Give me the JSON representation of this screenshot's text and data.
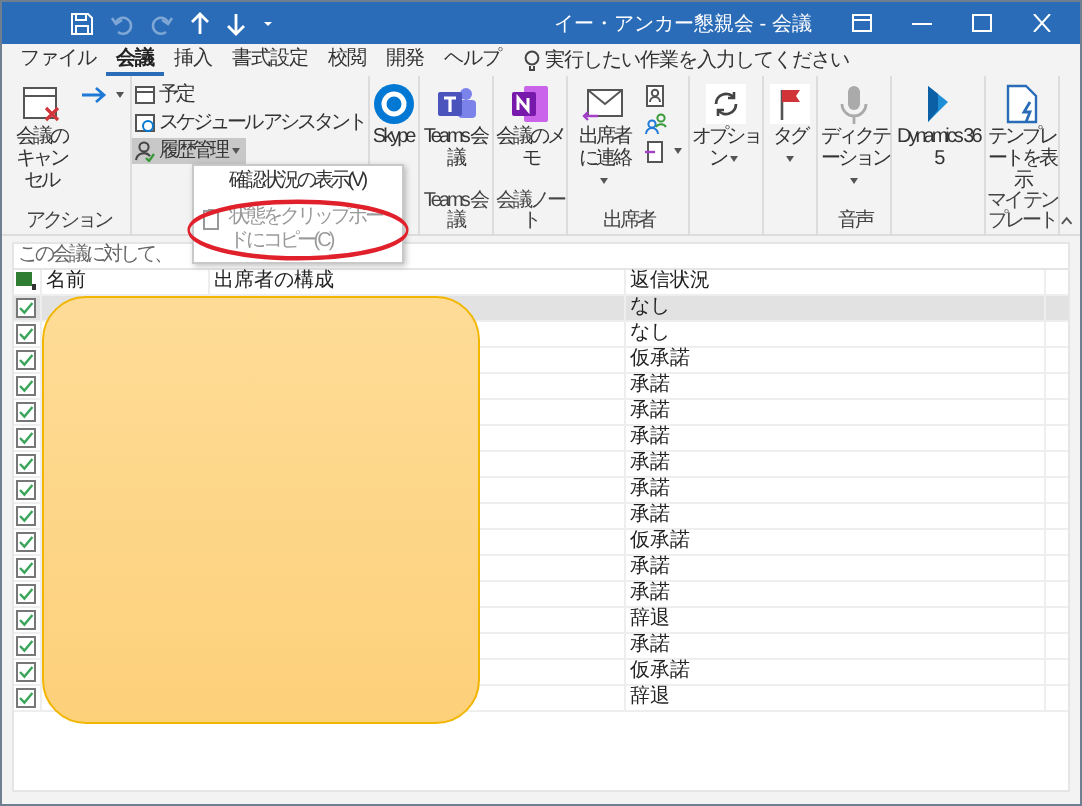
{
  "window": {
    "title": "イー・アンカー懇親会 - 会議"
  },
  "quick_access": [
    {
      "kind": "save",
      "disabled": false
    },
    {
      "kind": "undo",
      "disabled": true
    },
    {
      "kind": "redo",
      "disabled": true
    },
    {
      "kind": "up",
      "disabled": false
    },
    {
      "kind": "down",
      "disabled": false
    },
    {
      "kind": "customize",
      "disabled": false
    }
  ],
  "tabs": [
    {
      "label": "ファイル",
      "selected": false
    },
    {
      "label": "会議",
      "selected": true
    },
    {
      "label": "挿入",
      "selected": false
    },
    {
      "label": "書式設定",
      "selected": false
    },
    {
      "label": "校閲",
      "selected": false
    },
    {
      "label": "開発",
      "selected": false
    },
    {
      "label": "ヘルプ",
      "selected": false
    }
  ],
  "search": {
    "placeholder": "実行したい作業を入力してください"
  },
  "ribbon": {
    "groups": [
      {
        "label": "アクション",
        "buttons": [
          {
            "kind": "large",
            "label": "会議のキャンセル",
            "dropdown": false
          },
          {
            "kind": "mini",
            "dropdown": true
          }
        ]
      },
      {
        "buttons": [
          {
            "kind": "small",
            "label": "予定",
            "dropdown": false
          },
          {
            "kind": "small",
            "label": "スケジュール アシスタント",
            "dropdown": false
          },
          {
            "kind": "small",
            "label": "履歴管理",
            "dropdown": true,
            "expanded": true
          }
        ]
      },
      {
        "buttons": [
          {
            "kind": "large",
            "label": "Skype",
            "dropdown": false
          }
        ]
      },
      {
        "label": "Teams 会議",
        "buttons": [
          {
            "kind": "large",
            "label": "Teams 会議",
            "dropdown": false
          }
        ]
      },
      {
        "label": "会議ノート",
        "buttons": [
          {
            "kind": "large",
            "label": "会議のメモ",
            "dropdown": false
          }
        ]
      },
      {
        "label": "出席者",
        "buttons": [
          {
            "kind": "large",
            "label": "出席者に連絡",
            "dropdown": true
          },
          {
            "kind": "mini",
            "dropdown": false
          },
          {
            "kind": "mini",
            "dropdown": false
          },
          {
            "kind": "mini",
            "dropdown": true
          }
        ]
      },
      {
        "buttons": [
          {
            "kind": "large",
            "label": "オプション",
            "dropdown": true
          }
        ]
      },
      {
        "buttons": [
          {
            "kind": "large",
            "label": "タグ",
            "dropdown": true
          }
        ]
      },
      {
        "label": "音声",
        "buttons": [
          {
            "kind": "large",
            "label": "ディクテーション",
            "dropdown": true
          }
        ]
      },
      {
        "buttons": [
          {
            "kind": "large",
            "label": "Dynamics 365",
            "dropdown": false
          }
        ]
      },
      {
        "label": "マイ テンプレート",
        "buttons": [
          {
            "kind": "large",
            "label": "テンプレートを表示",
            "dropdown": false
          }
        ]
      }
    ]
  },
  "menu": {
    "items": [
      {
        "label": "確認状況の表示(V)",
        "disabled": false
      },
      {
        "label": "状態をクリップボードにコピー(C)",
        "disabled": true
      }
    ]
  },
  "info_bar": {
    "text": "この会議に対して、"
  },
  "table": {
    "columns": [
      "名前",
      "出席者の構成",
      "返信状況"
    ],
    "rows": [
      {
        "checked": true,
        "selected": true,
        "response": "なし"
      },
      {
        "checked": true,
        "selected": false,
        "response": "なし"
      },
      {
        "checked": true,
        "selected": false,
        "response": "仮承諾"
      },
      {
        "checked": true,
        "selected": false,
        "response": "承諾"
      },
      {
        "checked": true,
        "selected": false,
        "response": "承諾"
      },
      {
        "checked": true,
        "selected": false,
        "response": "承諾"
      },
      {
        "checked": true,
        "selected": false,
        "response": "承諾"
      },
      {
        "checked": true,
        "selected": false,
        "response": "承諾"
      },
      {
        "checked": true,
        "selected": false,
        "response": "承諾"
      },
      {
        "checked": true,
        "selected": false,
        "response": "仮承諾"
      },
      {
        "checked": true,
        "selected": false,
        "response": "承諾"
      },
      {
        "checked": true,
        "selected": false,
        "response": "承諾"
      },
      {
        "checked": true,
        "selected": false,
        "response": "辞退"
      },
      {
        "checked": true,
        "selected": false,
        "response": "承諾"
      },
      {
        "checked": true,
        "selected": false,
        "response": "仮承諾"
      },
      {
        "checked": true,
        "selected": false,
        "response": "辞退"
      }
    ]
  },
  "annotations": [
    {
      "kind": "redaction"
    },
    {
      "kind": "ellipse"
    }
  ]
}
